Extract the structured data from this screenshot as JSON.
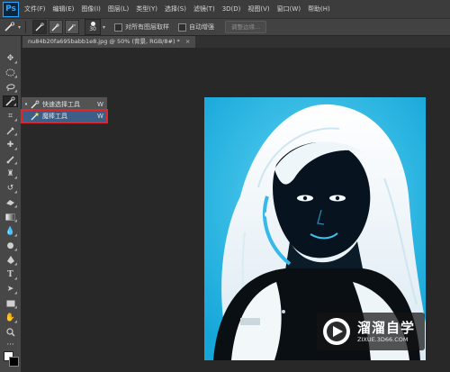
{
  "app": {
    "logo": "Ps"
  },
  "menu": [
    "文件(F)",
    "编辑(E)",
    "图像(I)",
    "图层(L)",
    "类型(Y)",
    "选择(S)",
    "滤镜(T)",
    "3D(D)",
    "视图(V)",
    "窗口(W)",
    "帮助(H)"
  ],
  "options": {
    "brush_size": "30",
    "sample_all_layers": "对所有图层取样",
    "auto_enhance": "自动增强",
    "refine_edge": "调整边缘..."
  },
  "document": {
    "tab_title": "nu84b20fa695babb1e8.jpg @ 50% (背景, RGB/8#) *",
    "close": "×"
  },
  "tool_flyout": {
    "items": [
      {
        "label": "快速选择工具",
        "shortcut": "W",
        "selected": true
      },
      {
        "label": "魔棒工具",
        "shortcut": "W",
        "selected": false
      }
    ]
  },
  "tools": [
    "move-tool-icon",
    "marquee-tool-icon",
    "lasso-tool-icon",
    "quick-selection-tool-icon",
    "crop-tool-icon",
    "eyedropper-tool-icon",
    "healing-brush-icon",
    "brush-tool-icon",
    "clone-stamp-icon",
    "history-brush-icon",
    "eraser-tool-icon",
    "gradient-tool-icon",
    "blur-tool-icon",
    "dodge-tool-icon",
    "pen-tool-icon",
    "type-tool-icon",
    "path-selection-icon",
    "rectangle-tool-icon",
    "hand-tool-icon",
    "zoom-tool-icon"
  ],
  "watermark": {
    "title": "溜溜自学",
    "url": "ZIXUE.3D66.COM"
  },
  "colors": {
    "accent": "#31a8ff",
    "highlight_outline": "#e0262b",
    "photo_bg": "#21b8e8"
  }
}
